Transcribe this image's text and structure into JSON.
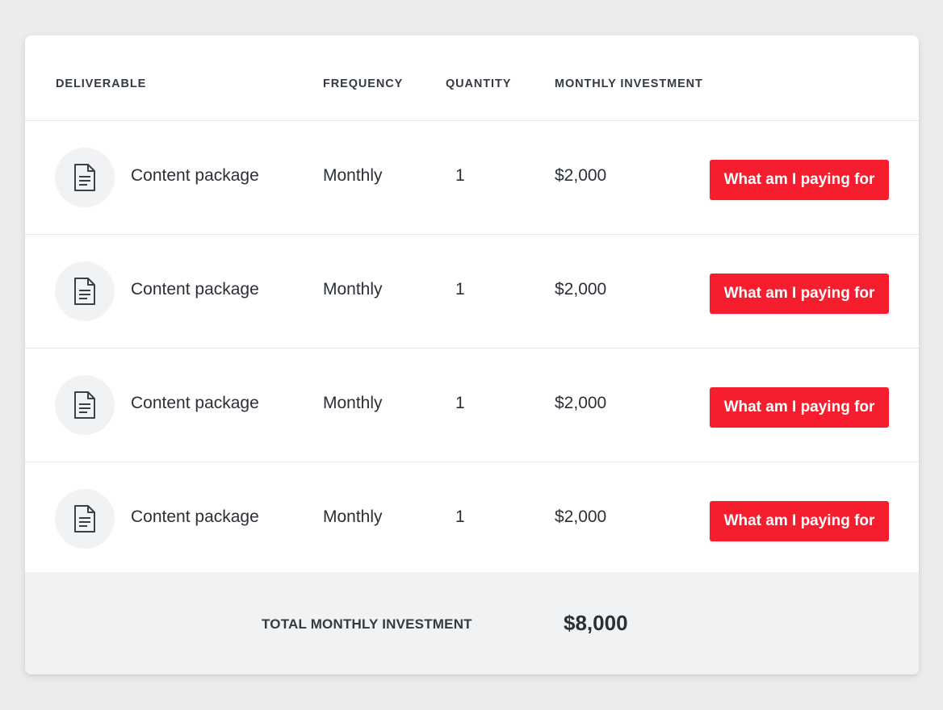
{
  "table": {
    "headers": {
      "deliverable": "DELIVERABLE",
      "frequency": "FREQUENCY",
      "quantity": "QUANTITY",
      "investment": "MONTHLY INVESTMENT"
    },
    "rows": [
      {
        "icon": "document-icon",
        "name": "Content package",
        "frequency": "Monthly",
        "quantity": "1",
        "investment": "$2,000",
        "action": "What am I paying for"
      },
      {
        "icon": "document-icon",
        "name": "Content package",
        "frequency": "Monthly",
        "quantity": "1",
        "investment": "$2,000",
        "action": "What am I paying for"
      },
      {
        "icon": "document-icon",
        "name": "Content package",
        "frequency": "Monthly",
        "quantity": "1",
        "investment": "$2,000",
        "action": "What am I paying for"
      },
      {
        "icon": "document-icon",
        "name": "Content package",
        "frequency": "Monthly",
        "quantity": "1",
        "investment": "$2,000",
        "action": "What am I paying for"
      }
    ]
  },
  "footer": {
    "total_label": "TOTAL MONTHLY INVESTMENT",
    "total_value": "$8,000"
  },
  "colors": {
    "accent_button": "#f51d2e",
    "page_background": "#ececec",
    "footer_background": "#f1f2f3"
  }
}
